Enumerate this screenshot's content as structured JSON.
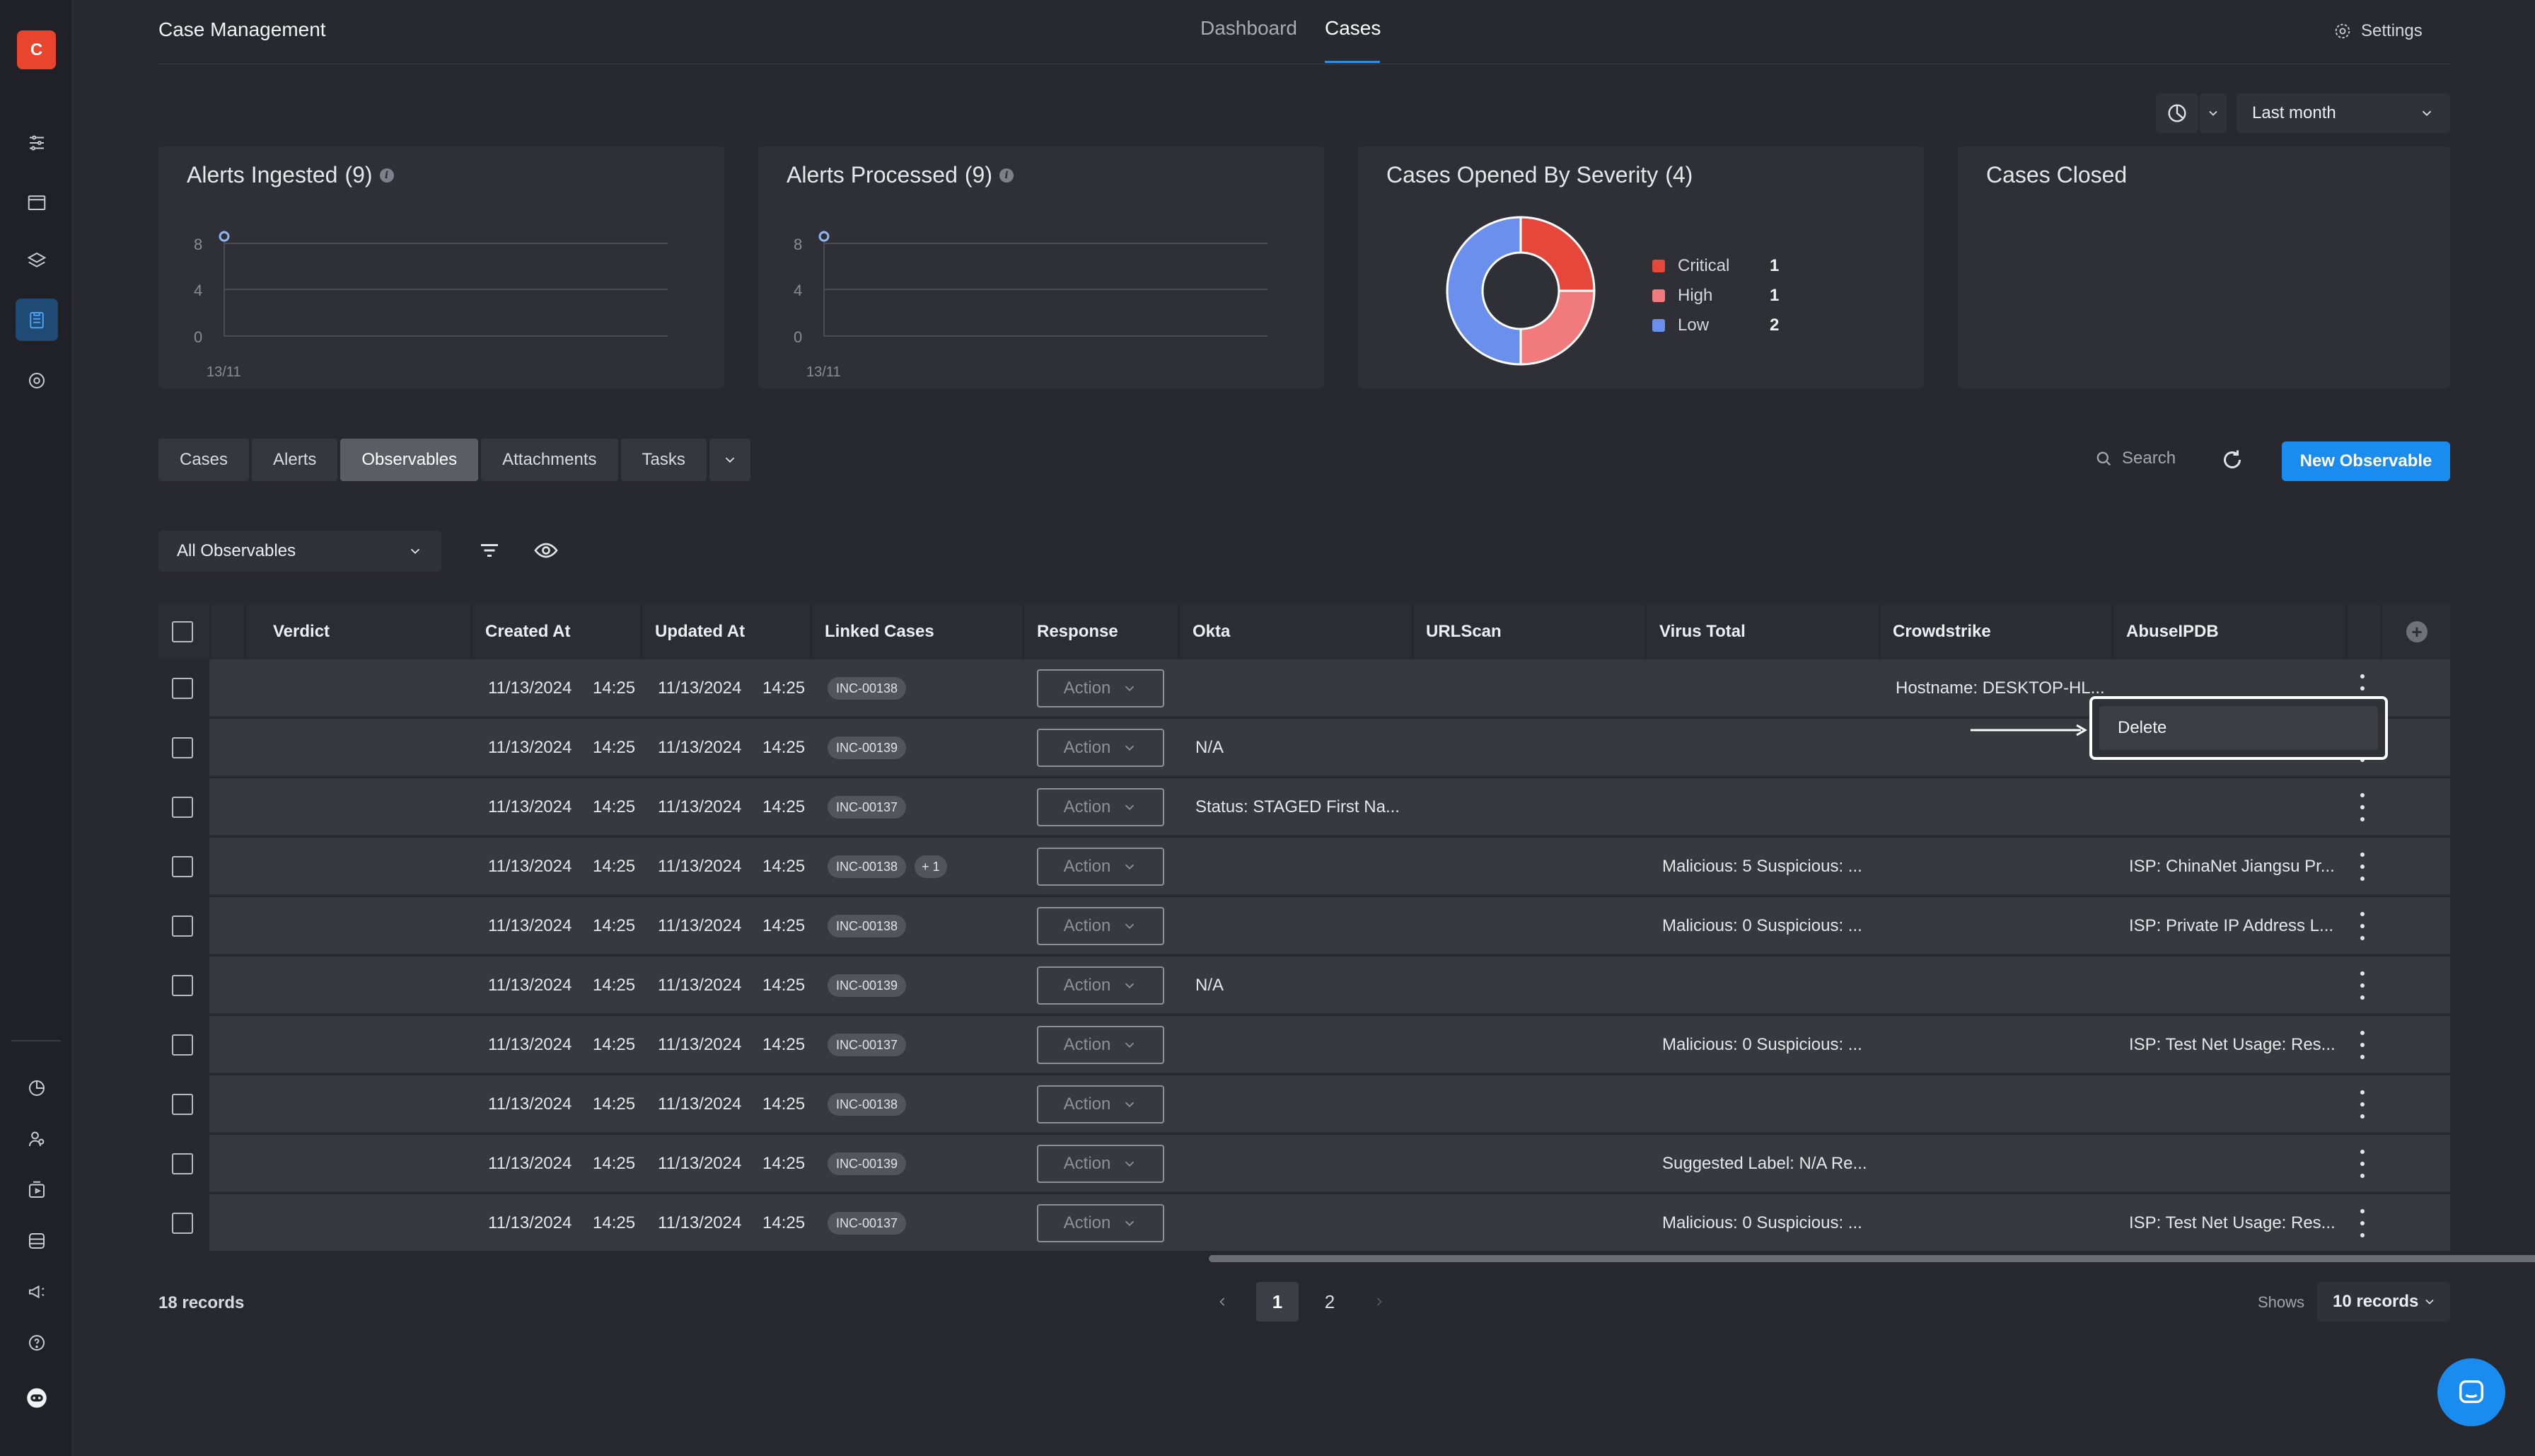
{
  "app": {
    "logo_letter": "C",
    "title": "Case Management"
  },
  "nav": {
    "tabs": [
      {
        "label": "Dashboard",
        "active": false
      },
      {
        "label": "Cases",
        "active": true
      }
    ],
    "settings_label": "Settings"
  },
  "time_range": {
    "selected": "Last month"
  },
  "cards": {
    "alerts_ingested": {
      "title": "Alerts Ingested",
      "count": "(9)",
      "y_ticks": [
        "8",
        "4",
        "0"
      ],
      "x_tick": "13/11"
    },
    "alerts_processed": {
      "title": "Alerts Processed",
      "count": "(9)",
      "y_ticks": [
        "8",
        "4",
        "0"
      ],
      "x_tick": "13/11"
    },
    "cases_by_severity": {
      "title": "Cases Opened By Severity",
      "count": "(4)",
      "legend": [
        {
          "label": "Critical",
          "value": "1",
          "color": "#e5483b"
        },
        {
          "label": "High",
          "value": "1",
          "color": "#f07a7c"
        },
        {
          "label": "Low",
          "value": "2",
          "color": "#6b8fec"
        }
      ]
    },
    "cases_closed": {
      "title": "Cases Closed"
    }
  },
  "chart_data": [
    {
      "type": "line",
      "title": "Alerts Ingested (9)",
      "x": [
        "13/11"
      ],
      "y_ticks": [
        0,
        4,
        8
      ],
      "ylim": [
        0,
        8
      ],
      "series": [
        {
          "values": [
            9
          ]
        }
      ]
    },
    {
      "type": "line",
      "title": "Alerts Processed (9)",
      "x": [
        "13/11"
      ],
      "y_ticks": [
        0,
        4,
        8
      ],
      "ylim": [
        0,
        8
      ],
      "series": [
        {
          "values": [
            9
          ]
        }
      ]
    },
    {
      "type": "pie",
      "title": "Cases Opened By Severity (4)",
      "categories": [
        "Critical",
        "High",
        "Low"
      ],
      "values": [
        1,
        1,
        2
      ],
      "colors": [
        "#e5483b",
        "#f07a7c",
        "#6b8fec"
      ],
      "legend": "right"
    }
  ],
  "section_tabs": [
    {
      "label": "Cases",
      "active": false
    },
    {
      "label": "Alerts",
      "active": false
    },
    {
      "label": "Observables",
      "active": true
    },
    {
      "label": "Attachments",
      "active": false
    },
    {
      "label": "Tasks",
      "active": false
    }
  ],
  "toolbar": {
    "search_placeholder": "Search",
    "new_button": "New Observable",
    "filter_selected": "All Observables"
  },
  "table": {
    "columns": [
      "Verdict",
      "Created At",
      "Updated At",
      "Linked Cases",
      "Response",
      "Okta",
      "URLScan",
      "Virus Total",
      "Crowdstrike",
      "AbuseIPDB"
    ],
    "rows": [
      {
        "created_date": "11/13/2024",
        "created_time": "14:25",
        "updated_date": "11/13/2024",
        "updated_time": "14:25",
        "case": "INC-00138",
        "extra": "",
        "action": "Action",
        "okta": "",
        "virus_total": "",
        "crowdstrike": "Hostname: DESKTOP-HL...",
        "abuseipdb": ""
      },
      {
        "created_date": "11/13/2024",
        "created_time": "14:25",
        "updated_date": "11/13/2024",
        "updated_time": "14:25",
        "case": "INC-00139",
        "extra": "",
        "action": "Action",
        "okta": "N/A",
        "virus_total": "",
        "crowdstrike": "",
        "abuseipdb": ""
      },
      {
        "created_date": "11/13/2024",
        "created_time": "14:25",
        "updated_date": "11/13/2024",
        "updated_time": "14:25",
        "case": "INC-00137",
        "extra": "",
        "action": "Action",
        "okta": "Status: STAGED First Na...",
        "virus_total": "",
        "crowdstrike": "",
        "abuseipdb": ""
      },
      {
        "created_date": "11/13/2024",
        "created_time": "14:25",
        "updated_date": "11/13/2024",
        "updated_time": "14:25",
        "case": "INC-00138",
        "extra": "+ 1",
        "action": "Action",
        "okta": "",
        "virus_total": "Malicious: 5 Suspicious: ...",
        "crowdstrike": "",
        "abuseipdb": "ISP: ChinaNet Jiangsu Pr..."
      },
      {
        "created_date": "11/13/2024",
        "created_time": "14:25",
        "updated_date": "11/13/2024",
        "updated_time": "14:25",
        "case": "INC-00138",
        "extra": "",
        "action": "Action",
        "okta": "",
        "virus_total": "Malicious: 0 Suspicious: ...",
        "crowdstrike": "",
        "abuseipdb": "ISP: Private IP Address L..."
      },
      {
        "created_date": "11/13/2024",
        "created_time": "14:25",
        "updated_date": "11/13/2024",
        "updated_time": "14:25",
        "case": "INC-00139",
        "extra": "",
        "action": "Action",
        "okta": "N/A",
        "virus_total": "",
        "crowdstrike": "",
        "abuseipdb": ""
      },
      {
        "created_date": "11/13/2024",
        "created_time": "14:25",
        "updated_date": "11/13/2024",
        "updated_time": "14:25",
        "case": "INC-00137",
        "extra": "",
        "action": "Action",
        "okta": "",
        "virus_total": "Malicious: 0 Suspicious: ...",
        "crowdstrike": "",
        "abuseipdb": "ISP: Test Net Usage: Res..."
      },
      {
        "created_date": "11/13/2024",
        "created_time": "14:25",
        "updated_date": "11/13/2024",
        "updated_time": "14:25",
        "case": "INC-00138",
        "extra": "",
        "action": "Action",
        "okta": "",
        "virus_total": "",
        "crowdstrike": "",
        "abuseipdb": ""
      },
      {
        "created_date": "11/13/2024",
        "created_time": "14:25",
        "updated_date": "11/13/2024",
        "updated_time": "14:25",
        "case": "INC-00139",
        "extra": "",
        "action": "Action",
        "okta": "",
        "virus_total": "Suggested Label: N/A Re...",
        "crowdstrike": "",
        "abuseipdb": ""
      },
      {
        "created_date": "11/13/2024",
        "created_time": "14:25",
        "updated_date": "11/13/2024",
        "updated_time": "14:25",
        "case": "INC-00137",
        "extra": "",
        "action": "Action",
        "okta": "",
        "virus_total": "Malicious: 0 Suspicious: ...",
        "crowdstrike": "",
        "abuseipdb": "ISP: Test Net Usage: Res..."
      }
    ]
  },
  "row_menu": {
    "items": [
      "Delete"
    ]
  },
  "footer": {
    "records": "18 records",
    "pages": [
      "1",
      "2"
    ],
    "current_page": "1",
    "shows_label": "Shows",
    "per_page": "10 records"
  },
  "colors": {
    "accent": "#1a8cf0",
    "brand": "#e8452c",
    "background": "#27292f",
    "card": "#2e3036"
  }
}
